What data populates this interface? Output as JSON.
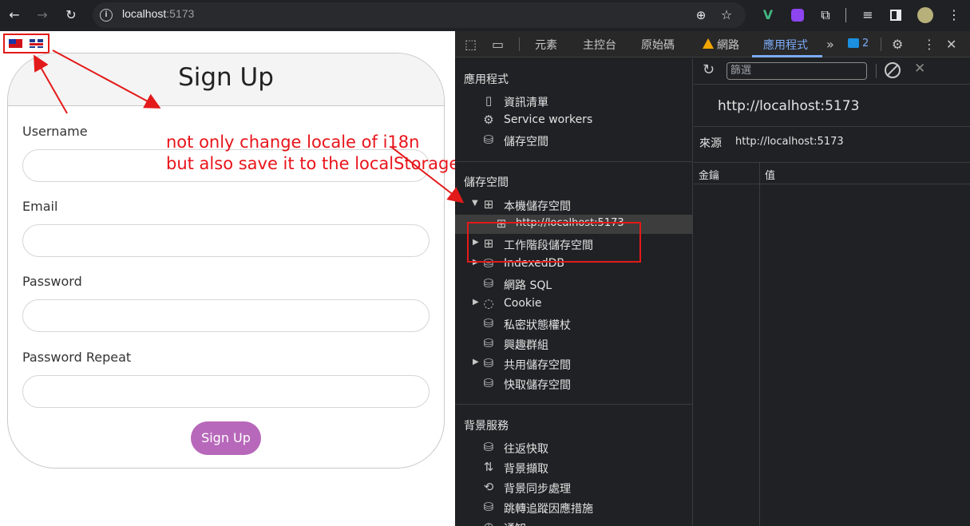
{
  "browser": {
    "url_host": "localhost",
    "url_port": ":5173",
    "icons": [
      "back-icon",
      "forward-icon",
      "reload-icon",
      "info-icon",
      "zoom-icon",
      "star-icon",
      "vue-extension-icon",
      "extension-icon",
      "puzzle-icon",
      "media-icon",
      "sidepanel-icon",
      "profile-avatar",
      "menu-icon"
    ]
  },
  "page": {
    "flags": [
      "tw",
      "gb"
    ],
    "title": "Sign Up",
    "fields": [
      {
        "label": "Username",
        "value": ""
      },
      {
        "label": "Email",
        "value": ""
      },
      {
        "label": "Password",
        "value": ""
      },
      {
        "label": "Password Repeat",
        "value": ""
      }
    ],
    "submit_label": "Sign Up",
    "button_color": "#b768ba"
  },
  "annotation": {
    "line1": "not only change locale of i18n",
    "line2": "but also save it to the localStorage",
    "color": "#e8141a"
  },
  "devtools": {
    "tabs": {
      "elements": "元素",
      "console": "主控台",
      "sources": "原始碼",
      "network": "網路",
      "application": "應用程式"
    },
    "message_count": "2",
    "sidebar": {
      "app_section": "應用程式",
      "app_items": [
        "資訊清單",
        "Service workers",
        "儲存空間"
      ],
      "storage_section": "儲存空間",
      "storage_items": {
        "local_storage": "本機儲存空間",
        "local_storage_origin": "http://localhost:5173",
        "session_storage": "工作階段儲存空間",
        "indexeddb": "IndexedDB",
        "websql": "網路 SQL",
        "cookie": "Cookie",
        "private_state": "私密狀態權杖",
        "interest_groups": "興趣群組",
        "shared_storage": "共用儲存空間",
        "cache_storage": "快取儲存空間"
      },
      "background_section": "背景服務",
      "background_items": [
        "往返快取",
        "背景擷取",
        "背景同步處理",
        "跳轉追蹤因應措施",
        "通知"
      ]
    },
    "main": {
      "filter_placeholder": "篩選",
      "origin_title": "http://localhost:5173",
      "origin_label": "來源",
      "origin_value": "http://localhost:5173",
      "col_key": "金鑰",
      "col_value": "值"
    }
  }
}
